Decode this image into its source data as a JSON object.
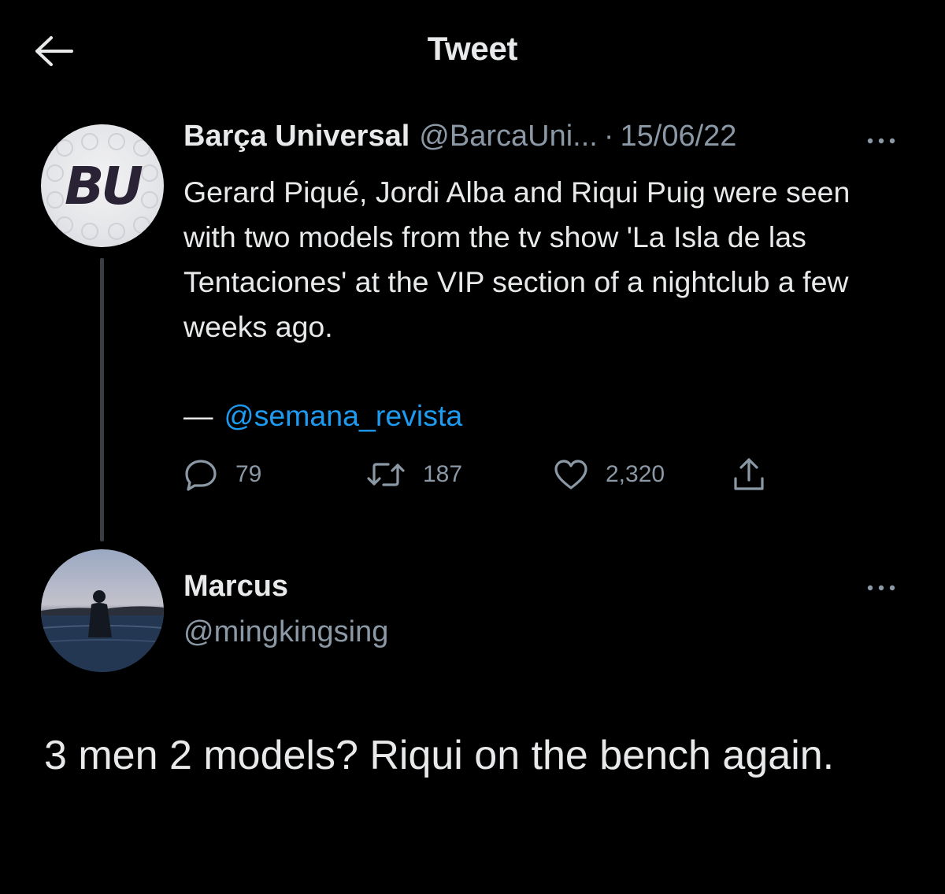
{
  "header": {
    "title": "Tweet",
    "back_icon": "arrow-left-icon"
  },
  "original_tweet": {
    "avatar": {
      "logo_text": "BU",
      "background": "#e6e7ea",
      "logo_color": "#2a2336"
    },
    "display_name": "Barça Universal",
    "handle": "@BarcaUni...",
    "separator": "·",
    "date": "15/06/22",
    "text": "Gerard Piqué, Jordi Alba and Riqui Puig were seen with two models from the tv show 'La Isla de las Tentaciones' at the VIP section of a nightclub a few weeks ago.",
    "source_dash": "—",
    "source_mention": "@semana_revista",
    "actions": {
      "replies": "79",
      "retweets": "187",
      "likes": "2,320"
    }
  },
  "reply_tweet": {
    "display_name": "Marcus",
    "handle": "@mingkingsing",
    "text": "3 men 2 models? Riqui on the bench again."
  },
  "colors": {
    "background": "#000000",
    "primary_text": "#e7e9ea",
    "secondary_text": "#8b98a5",
    "link": "#1d9bf0",
    "thread_line": "#3a3d41"
  }
}
